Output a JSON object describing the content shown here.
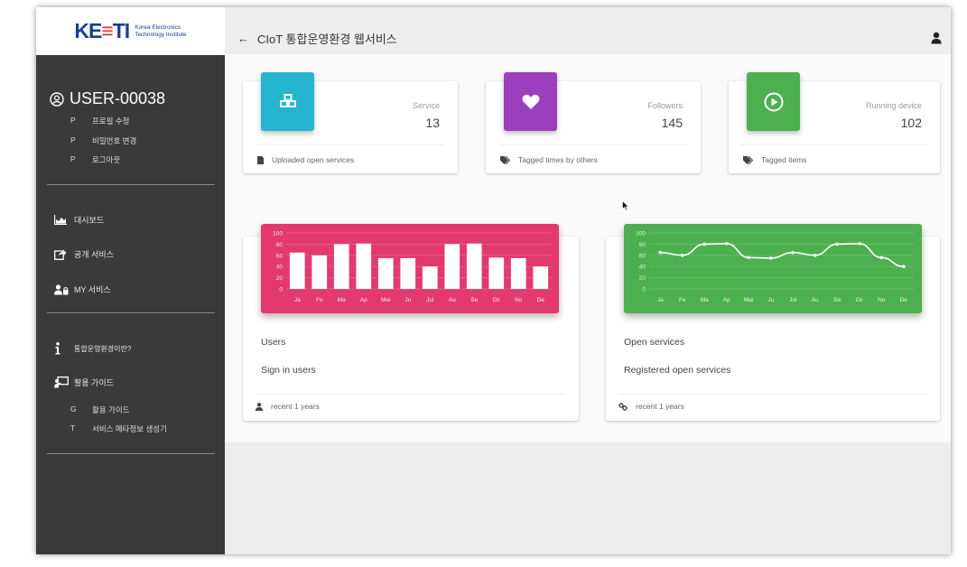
{
  "logo": {
    "mark": "KETI",
    "line1": "Korea Electronics",
    "line2": "Technology Institute"
  },
  "header": {
    "back": "←",
    "title": "CIoT 통합운영환경 웹서비스"
  },
  "sidebar": {
    "username": "USER-00038",
    "user_menu": [
      {
        "key": "P",
        "label": "프로필 수정"
      },
      {
        "key": "P",
        "label": "비밀번호 변경"
      },
      {
        "key": "P",
        "label": "로그아웃"
      }
    ],
    "nav": [
      {
        "label": "대시보드",
        "icon": "area-chart-icon"
      },
      {
        "label": "공개 서비스",
        "icon": "share-icon"
      },
      {
        "label": "MY 서비스",
        "icon": "users-lock-icon"
      }
    ],
    "info": [
      {
        "label": "통합운영환경이란?",
        "icon": "info-icon"
      },
      {
        "label": "활용 가이드",
        "icon": "presentation-icon"
      }
    ],
    "guide_menu": [
      {
        "key": "G",
        "label": "활용 가이드"
      },
      {
        "key": "T",
        "label": "서비스 메타정보 생성기"
      }
    ]
  },
  "stats": [
    {
      "label": "Service",
      "value": "13",
      "footer": "Uploaded open services",
      "color": "#26b5ce",
      "icon": "cubes-icon",
      "footer_icon": "file-icon"
    },
    {
      "label": "Followers",
      "value": "145",
      "footer": "Tagged times by others",
      "color": "#9c3fbd",
      "icon": "heart-icon",
      "footer_icon": "tags-icon"
    },
    {
      "label": "Running device",
      "value": "102",
      "footer": "Tagged items",
      "color": "#4caf50",
      "icon": "play-circle-icon",
      "footer_icon": "tags-icon"
    }
  ],
  "chart_data": [
    {
      "type": "bar",
      "title": "Users",
      "subtitle": "Sign in users",
      "footer": "recent 1 years",
      "color": "#e23a6e",
      "categories": [
        "Ja",
        "Fe",
        "Ma",
        "Ap",
        "Mai",
        "Ju",
        "Jul",
        "Au",
        "Se",
        "Oc",
        "No",
        "De"
      ],
      "values": [
        65,
        60,
        80,
        81,
        55,
        55,
        40,
        80,
        81,
        56,
        55,
        40
      ],
      "yticks": [
        0,
        20,
        40,
        60,
        80,
        100
      ],
      "ylim": [
        0,
        100
      ]
    },
    {
      "type": "line",
      "title": "Open services",
      "subtitle": "Registered open services",
      "footer": "recent 1 years",
      "color": "#4caf50",
      "categories": [
        "Ja",
        "Fe",
        "Ma",
        "Ap",
        "Mai",
        "Ju",
        "Jul",
        "Au",
        "Se",
        "Oc",
        "No",
        "De"
      ],
      "values": [
        65,
        60,
        80,
        81,
        56,
        55,
        65,
        60,
        80,
        81,
        56,
        40
      ],
      "yticks": [
        0,
        20,
        40,
        60,
        80,
        100
      ],
      "ylim": [
        0,
        100
      ]
    }
  ]
}
